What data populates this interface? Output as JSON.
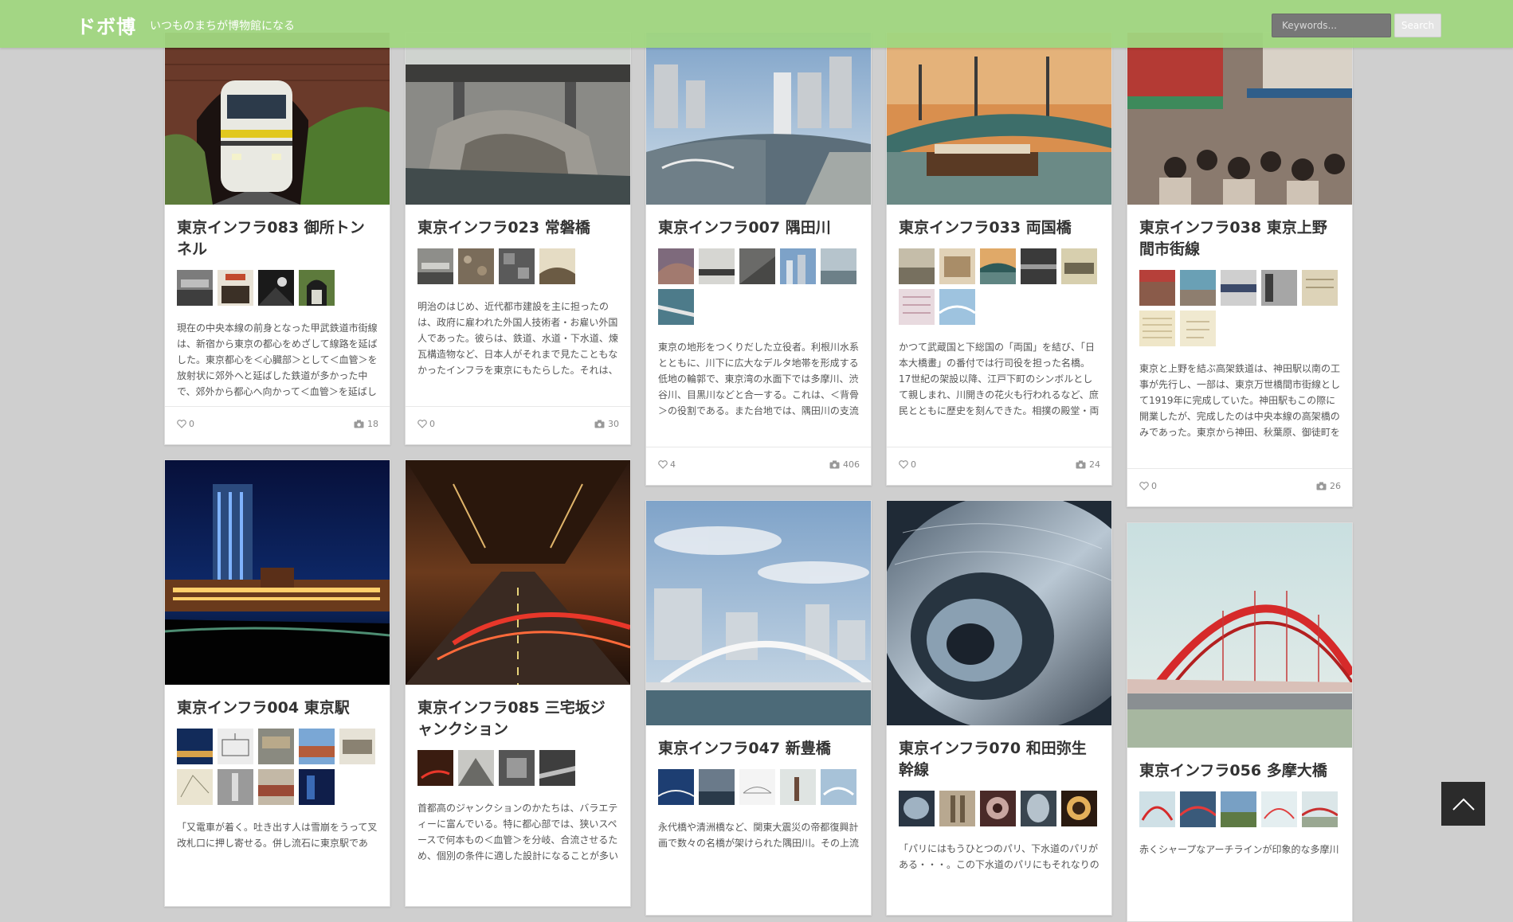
{
  "header": {
    "logo": "ドボ博",
    "tagline": "いつものまちが博物館になる",
    "search_placeholder": "Keywords...",
    "search_label": "Search"
  },
  "cards": [
    {
      "title": "東京インフラ083 御所トンネル",
      "desc": "現在の中央本線の前身となった甲武鉄道市街線は、新宿から東京の都心をめざして線路を延ばした。東京都心を＜心臓部＞として＜血管＞を放射状に郊外へと延ばした鉄道が多かった中で、郊外から都心へ向かって＜血管＞を延ばした鉄道が甲武 […] ...",
      "likes": "0",
      "photos": "18"
    },
    {
      "title": "東京インフラ023 常磐橋",
      "desc": "明治のはじめ、近代都市建設を主に担ったのは、政府に雇われた外国人技術者・お雇い外国人であった。彼らは、鉄道、水道・下水道、煉瓦構造物など、日本人がそれまで見たこともなかったインフラを東京にもたらした。それは、まさに文明開 […] ...",
      "likes": "0",
      "photos": "30"
    },
    {
      "title": "東京インフラ007 隅田川",
      "desc": "東京の地形をつくりだした立役者。利根川水系とともに、川下に広大なデルタ地帯を形成する低地の輪郭で、東京湾の水面下では多摩川、渋谷川、目黒川などと合一する。これは、＜背骨＞の役割である。また台地では、隅田川の支流が水の流れ […] ...",
      "likes": "4",
      "photos": "406"
    },
    {
      "title": "東京インフラ033 両国橋",
      "desc": "かつて武蔵国と下総国の「両国」を結び、「日本大橋畫」の番付では行司役を担った名橋。17世紀の架設以降、江戸下町のシンボルとして親しまれ、川開きの花火も行われるなど、庶民とともに歴史を刻んできた。相撲の殿堂・両国国技館も近 […] ...",
      "likes": "0",
      "photos": "24"
    },
    {
      "title": "東京インフラ038 東京上野間市街線",
      "desc": "東京と上野を結ぶ高架鉄道は、神田駅以南の工事が先行し、一部は、東京万世橋間市街線として1919年に完成していた。神田駅もこの際に開業したが、完成したのは中央本線の高架橋のみであった。東京から神田、秋葉原、御徒町を経て上野 […] ...",
      "likes": "0",
      "photos": "26"
    },
    {
      "title": "東京インフラ004 東京駅",
      "desc": "「又電車が着く。吐き出す人は雪崩をうって叉改札口に押し寄せる。併し流石に東京駅であ"
    },
    {
      "title": "東京インフラ085 三宅坂ジャンクション",
      "desc": "首都高のジャンクションのかたちは、バラエティーに富んでいる。特に都心部では、狭いスペースで何本もの＜血管＞を分岐、合流させるため、個別の条件に適した設計になることが多い"
    },
    {
      "title": "東京インフラ047 新豊橋",
      "desc": "永代橋や清洲橋など、関東大震災の帝都復興計画で数々の名橋が架けられた隅田川。その上流"
    },
    {
      "title": "東京インフラ070 和田弥生幹線",
      "desc": "「パリにはもうひとつのパリ、下水道のパリがある・・・。この下水道のパリにもそれなりの"
    },
    {
      "title": "東京インフラ056 多摩大橋",
      "desc": "赤くシャープなアーチラインが印象的な多摩川"
    }
  ]
}
